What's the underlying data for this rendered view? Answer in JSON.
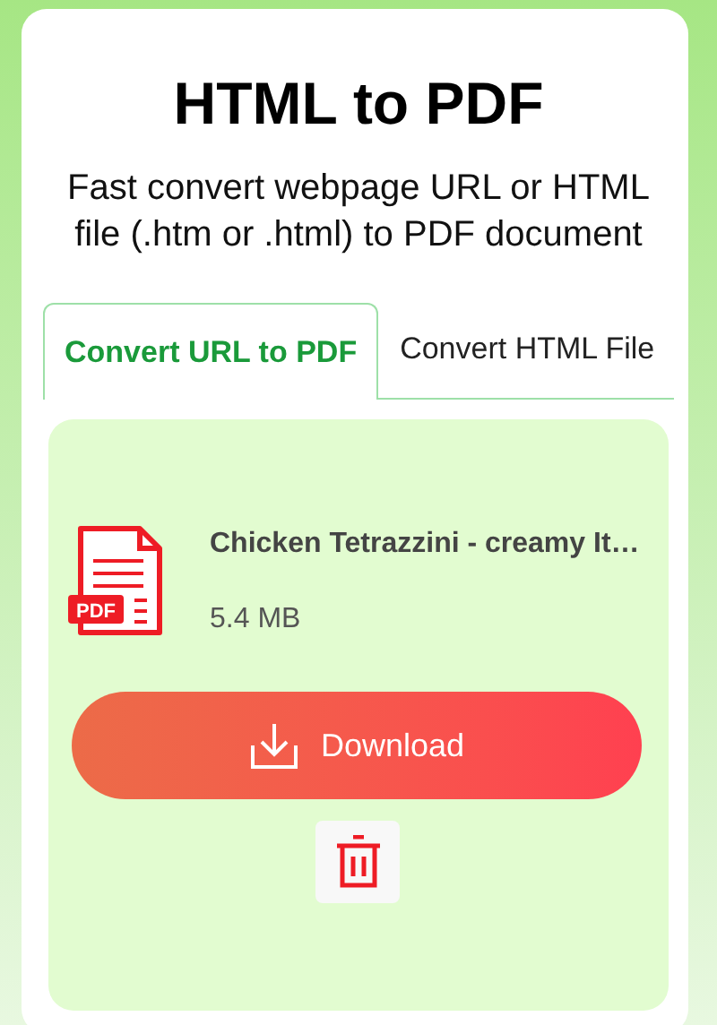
{
  "title": "HTML to PDF",
  "subtitle": "Fast convert webpage URL or HTML file (.htm or .html) to PDF document",
  "tabs": [
    {
      "label": "Convert URL to PDF",
      "selected": true
    },
    {
      "label": "Convert HTML File",
      "selected": false
    }
  ],
  "file": {
    "badge": "PDF",
    "name": "Chicken Tetrazzini - creamy It…",
    "size": "5.4 MB"
  },
  "download_button": "Download"
}
